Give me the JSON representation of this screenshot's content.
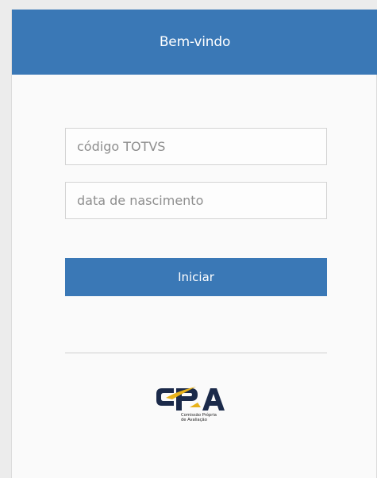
{
  "header": {
    "title": "Bem-vindo"
  },
  "form": {
    "codigo_placeholder": "código TOTVS",
    "codigo_value": "",
    "nascimento_placeholder": "data de nascimento",
    "nascimento_value": "",
    "submit_label": "Iniciar"
  },
  "logo": {
    "acronym": "CPA",
    "subtitle_line1": "Comissão Própria",
    "subtitle_line2": "de Avaliação"
  },
  "colors": {
    "primary": "#3a78b6",
    "logo_dark": "#1b2a4a",
    "logo_accent": "#e8b21a",
    "background": "#fafafa"
  }
}
